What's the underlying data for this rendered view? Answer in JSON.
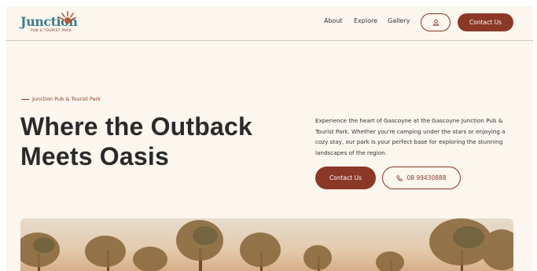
{
  "logo": {
    "word": "Junction",
    "sub": "PUB & TOURIST PARK"
  },
  "nav": {
    "about": "About",
    "explore": "Explore",
    "gallery": "Gallery"
  },
  "header": {
    "contact_label": "Contact Us"
  },
  "hero": {
    "eyebrow": "Junction Pub & Tourist Park",
    "headline": "Where the Outback Meets Oasis",
    "description": "Experience the heart of Gascoyne at the Gascoyne Junction Pub & Tourist Park. Whether you're camping under the stars or enjoying a cozy stay, our park is your perfect base for exploring the stunning landscapes of the region.",
    "contact_label": "Contact Us",
    "phone": "08 99430888"
  },
  "icons": {
    "user": "user-icon",
    "phone": "phone-icon",
    "sun": "sun-logo-icon"
  },
  "colors": {
    "accent": "#8b3826",
    "teal": "#3e7d8a",
    "background": "#fbf6ee"
  }
}
